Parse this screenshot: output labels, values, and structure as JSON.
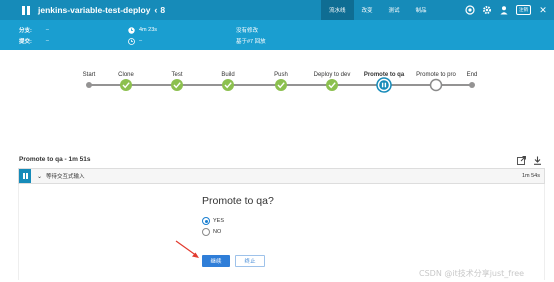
{
  "header": {
    "title": "jenkins-variable-test-deploy",
    "run_number": "8",
    "tabs": [
      {
        "label": "流水线",
        "active": true
      },
      {
        "label": "改变",
        "active": false
      },
      {
        "label": "测试",
        "active": false
      },
      {
        "label": "制品",
        "active": false
      }
    ],
    "icons": [
      "replay-icon",
      "gear-icon",
      "user-icon",
      "exit-button-icon",
      "close-icon"
    ],
    "exit_label": "注销",
    "colors": {
      "primary": "#168bb9",
      "band": "#1a9ed0",
      "success": "#8cc04f",
      "paused": "#168bb9"
    }
  },
  "info": {
    "branch_label": "分支:",
    "branch_value": "–",
    "commit_label": "提交:",
    "commit_value": "–",
    "duration": "4m 23s",
    "started": "–",
    "changes": "没有修改",
    "replayed": "基于#7 回放"
  },
  "pipeline": {
    "stages": [
      {
        "name": "Start",
        "status": "start"
      },
      {
        "name": "Clone",
        "status": "success"
      },
      {
        "name": "Test",
        "status": "success"
      },
      {
        "name": "Build",
        "status": "success"
      },
      {
        "name": "Push",
        "status": "success"
      },
      {
        "name": "Deploy to dev",
        "status": "success"
      },
      {
        "name": "Promote to qa",
        "status": "paused"
      },
      {
        "name": "Promote to pro",
        "status": "not-built"
      },
      {
        "name": "End",
        "status": "end"
      }
    ]
  },
  "step": {
    "title": "Promote to qa - 1m 51s",
    "row_label": "等待交互式输入",
    "row_time": "1m 54s"
  },
  "input": {
    "question": "Promote to qa?",
    "options": [
      {
        "label": "YES",
        "selected": true
      },
      {
        "label": "NO",
        "selected": false
      }
    ],
    "proceed_label": "继续",
    "abort_label": "终止"
  },
  "watermark": "CSDN @it技术分享just_free"
}
